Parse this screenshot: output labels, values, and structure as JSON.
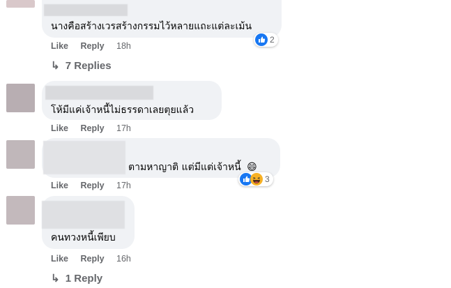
{
  "comments": [
    {
      "text": "นางคือสร้างเวรสร้างกรรมไว้หลายแถะแต่ละเม้น",
      "like": "Like",
      "reply": "Reply",
      "time": "18h",
      "reaction_icons": [
        "like-icon"
      ],
      "reaction_count": "2"
    },
    {
      "text": "โห้มีแค่เจ้าหนี้ไม่ธรรดาเลยตุยแล้ว",
      "like": "Like",
      "reply": "Reply",
      "time": "17h"
    },
    {
      "text": "ตามหาญาติ แต่มีแต่เจ้าหนี้",
      "emoji": "😄",
      "like": "Like",
      "reply": "Reply",
      "time": "17h",
      "reaction_icons": [
        "like-icon",
        "haha-icon"
      ],
      "reaction_count": "3"
    },
    {
      "text": "คนทวงหนี้เพียบ",
      "like": "Like",
      "reply": "Reply",
      "time": "16h"
    }
  ],
  "replies_links": [
    {
      "label": "7 Replies"
    },
    {
      "label": "1 Reply"
    }
  ],
  "colors": {
    "bubble": "#f0f2f5",
    "action_text": "#65676b",
    "like_blue": "#1877f2",
    "haha_yellow": "#f7b125"
  }
}
